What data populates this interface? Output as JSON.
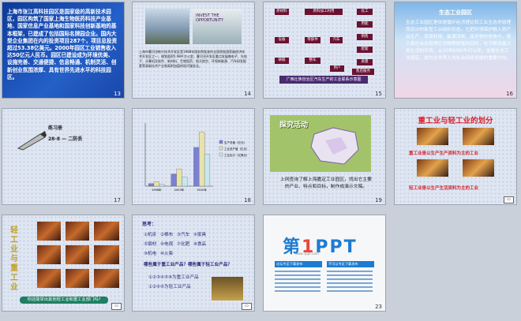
{
  "slides": [
    {
      "num": "13",
      "text": "上海市张江高科技园区是国家级的高新技术园区，园区构筑了国家上海生物医药科技产业基地、国家信息产业基地和国家科技创新基地的基本框架，已建成了包括国际名牌园企业。国内大型企业集团在内的投资项目287个，项目总投资超过53.38亿美元。2000年园区工业销售收入达50亿元人民币。园区已建设成为环境优美、设施完善、交通便捷、信息畅通、机制灵活、创新创业氛围浓厚、具有世界先进水平的科技园区。"
    },
    {
      "num": "14",
      "poster": "INVEST THE OPPORTUNITY",
      "text": "上海市曹河泾新兴技术开发区是1988年国务院批准的全国首批国家级经济技术开发区之一，规划面积5.98平方公里，曹河泾开发区重点发展微电子、光电子、计算机及软件、新材料、生物医药、航天航空、环保新能源、汽车研发配套等高新技术产业和高附加值的现代服务业。"
    },
    {
      "num": "15",
      "boxes": [
        "原材料",
        "原料加工利用",
        "化工",
        "用能",
        "设备",
        "零部件",
        "汽车",
        "销售",
        "配套",
        "铸锻",
        "整车",
        "质量",
        "用户",
        "售后服务"
      ],
      "caption": "广西壮族自治区汽车生产的工业联系示意图"
    },
    {
      "num": "16",
      "title": "生态工业园区",
      "body": "生态工业园区是依据循环经济理论和工业生态学原理而设计的新型工业组织形态。它把环境保护融入到产品生产、资源利用、能源消耗、废弃物的排放中，使人类社会在取得巨大物质财富的同时，也不断改善人类生活的环境。从20世纪90年代以来，发展生态工业园区，成为全世界人类社会持续发展的重要方向。"
    },
    {
      "num": "17",
      "caption_line1": "练习册",
      "caption_line2": "28-8 — 二防丢"
    },
    {
      "num": "18",
      "chart_data": {
        "type": "bar",
        "categories": [
          "1998年",
          "2003年",
          "2010年"
        ],
        "series": [
          {
            "name": "生产总值（亿元）",
            "values": [
              120,
              580,
              1840
            ]
          },
          {
            "name": "工业总产值（亿元）",
            "values": [
              200,
              820,
              2560
            ]
          },
          {
            "name": "工业出口（亿美元）",
            "values": [
              80,
              420,
              1520
            ]
          }
        ],
        "ylim": [
          0,
          3000
        ]
      },
      "legend": [
        "生产总值（亿元）",
        "工业总产值（亿元）",
        "工业出口（亿美元）"
      ]
    },
    {
      "num": "19",
      "title": "探究活动",
      "text": "上网查询了解上海嘉定工业园区，找出它主要的产业、特点和目标，制作成演示文稿。"
    },
    {
      "num": "20",
      "title": "重工业与轻工业的划分",
      "line1": "重工业是以生产生产资料为主的工业",
      "line2": "轻工业是以生产生活资料为主的工业"
    },
    {
      "num": "21",
      "vertical": "轻工业与重工业",
      "bar": "你还能举出其他轻工业和重工业部门吗?"
    },
    {
      "num": "22",
      "q": "思考：",
      "row1": "①机床 ②棉布 ③汽车 ④家具",
      "row2": "⑤钢材 ⑥电视 ⑦化肥 ⑧食品",
      "row3": "⑨机电 ⑩火柴",
      "q2": "哪些属于重工业产品？哪些属于轻工业产品？",
      "a1": "①②③④⑤⑧为重工业产品",
      "a2": "①②④⑥为轻工业产品"
    },
    {
      "num": "23",
      "logo_main": "第",
      "logo_accent": "1",
      "logo_end": "PPT",
      "sub": "www.1ppt.com",
      "left_box": "论坛专区下载发布",
      "right_box": "不可以专区下载发布"
    }
  ]
}
